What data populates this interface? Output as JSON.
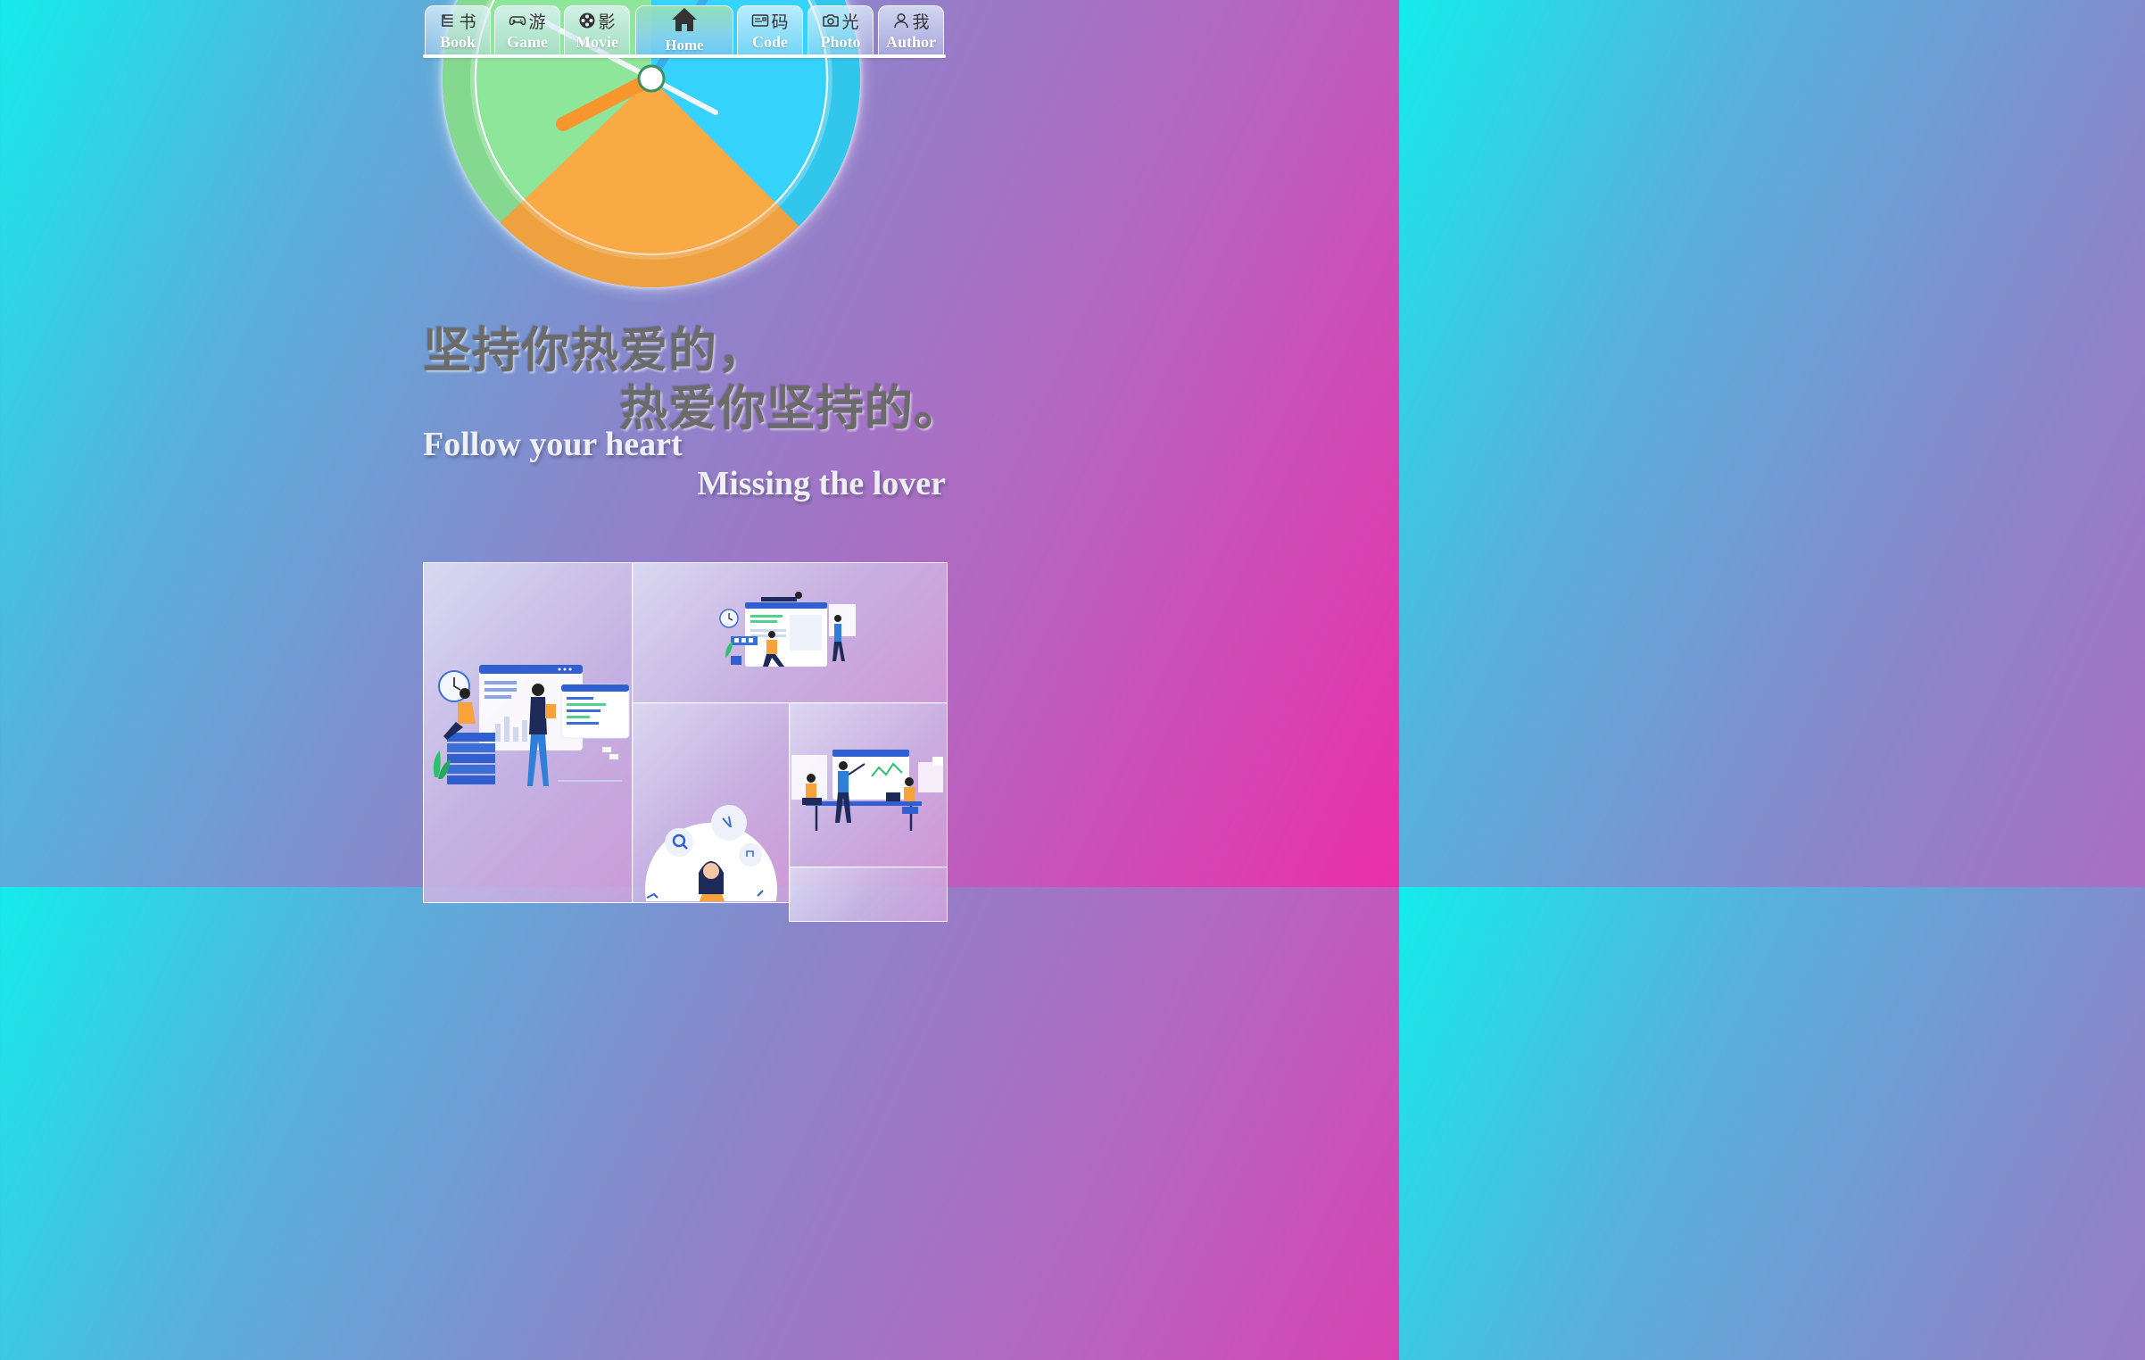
{
  "nav": {
    "items": [
      {
        "icon": "book-icon",
        "cn": "书",
        "en": "Book"
      },
      {
        "icon": "gamepad-icon",
        "cn": "游",
        "en": "Game"
      },
      {
        "icon": "film-reel-icon",
        "cn": "影",
        "en": "Movie"
      },
      {
        "icon": "home-icon",
        "cn": "",
        "en": "Home"
      },
      {
        "icon": "code-card-icon",
        "cn": "码",
        "en": "Code"
      },
      {
        "icon": "camera-icon",
        "cn": "光",
        "en": "Photo"
      },
      {
        "icon": "user-icon",
        "cn": "我",
        "en": "Author"
      }
    ],
    "active": "Home"
  },
  "clock": {
    "colors": {
      "green": "#8ee69a",
      "blue": "#35d3fb",
      "orange": "#ffb454",
      "hour_hand": "#f7962c"
    }
  },
  "slogan": {
    "cn_line1": "坚持你热爱的，",
    "cn_line2": "热爱你坚持的。",
    "en_line1": "Follow your heart",
    "en_line2": "Missing the lover"
  },
  "gallery": {
    "tiles": [
      "illustration-developer-dashboard",
      "illustration-team-website",
      "illustration-search-person",
      "illustration-team-meeting"
    ]
  }
}
